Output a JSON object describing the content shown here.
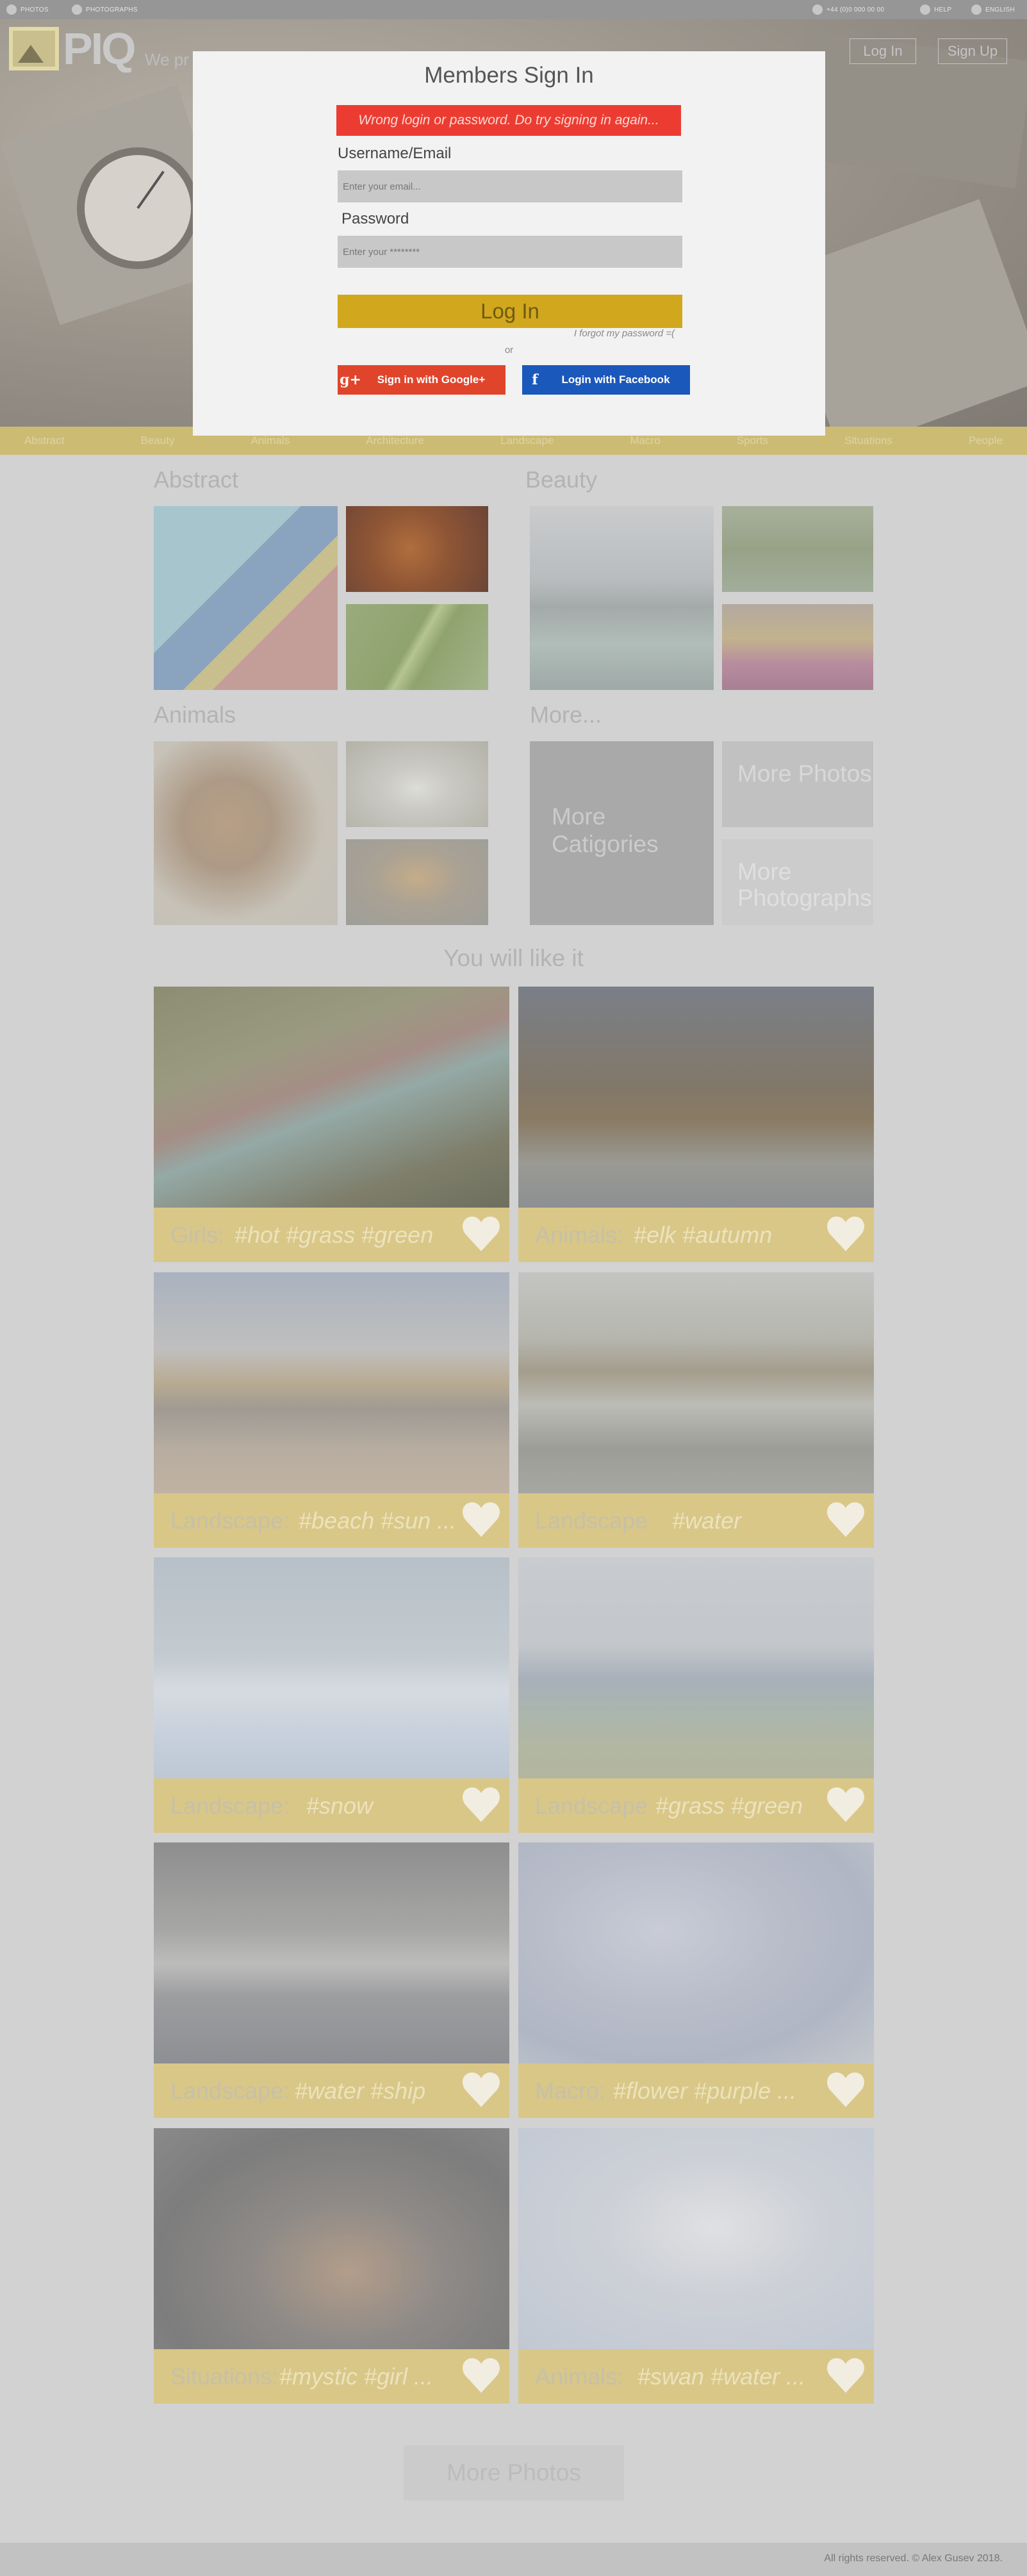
{
  "topbar": {
    "left": [
      "PHOTOS",
      "PHOTOGRAPHS"
    ],
    "right": [
      "+44 (0)0 000 00 00",
      "HELP",
      "ENGLISH"
    ]
  },
  "hero": {
    "logo_text": "PIQ",
    "tagline": "We pr",
    "login_btn": "Log In",
    "signup_btn": "Sign Up"
  },
  "nav": {
    "items": [
      "Abstract",
      "Beauty",
      "Animals",
      "Architecture",
      "Landscape",
      "Macro",
      "Sports",
      "Situations",
      "People"
    ]
  },
  "modal": {
    "title": "Members Sign In",
    "error": "Wrong login or password. Do try signing in again...",
    "username_label": "Username/Email",
    "username_placeholder": "Enter your email...",
    "password_label": "Password",
    "password_placeholder": "Enter your ********",
    "login_btn": "Log In",
    "forgot": "I forgot my password =(",
    "or": "or",
    "google_btn": "Sign in with Google+",
    "facebook_btn": "Login with Facebook"
  },
  "categories": {
    "abstract": "Abstract",
    "beauty": "Beauty",
    "animals": "Animals",
    "more": "More...",
    "more_categories": "More Catigories",
    "more_photos_tile": "More Photos",
    "more_photographs_tile": "More Photographs"
  },
  "feed": {
    "title": "You will like it",
    "cards": [
      {
        "category": "Girls:",
        "tags": "#hot #grass #green"
      },
      {
        "category": "Animals:",
        "tags": "#elk #autumn"
      },
      {
        "category": "Landscape:",
        "tags": "#beach #sun ..."
      },
      {
        "category": "Landscape",
        "tags": "#water"
      },
      {
        "category": "Landscape:",
        "tags": "#snow"
      },
      {
        "category": "Landscape",
        "tags": "#grass #green"
      },
      {
        "category": "Landscape:",
        "tags": "#water #ship"
      },
      {
        "category": "Macro:",
        "tags": "#flower #purple ..."
      },
      {
        "category": "Situations:",
        "tags": "#mystic #girl ..."
      },
      {
        "category": "Animals:",
        "tags": "#swan #water ..."
      }
    ],
    "more_btn": "More Photos"
  },
  "footer": {
    "copyright": "All rights reserved. © Alex Gusev 2018."
  },
  "colors": {
    "accent": "#d1a71d",
    "error": "#ec3c31",
    "facebook": "#1b58bb",
    "google": "#e0452c"
  }
}
